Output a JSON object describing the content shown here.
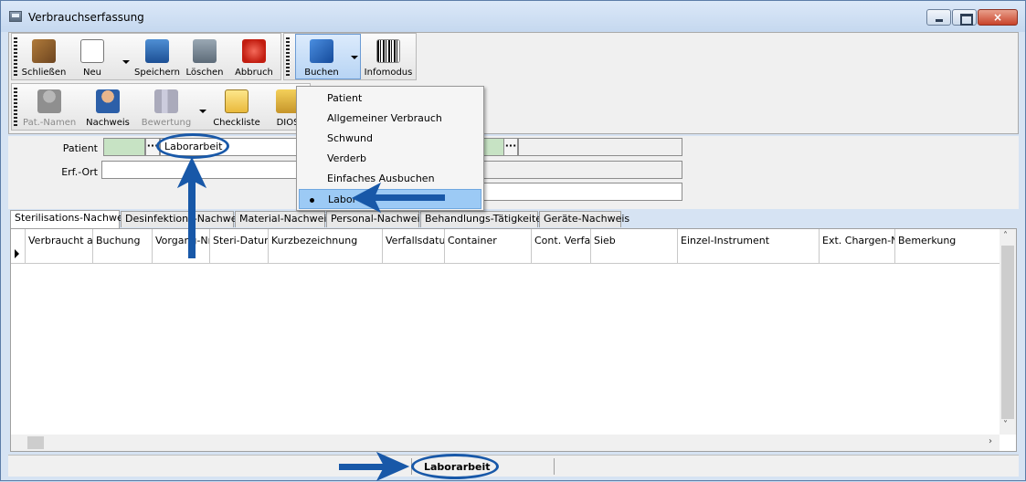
{
  "window": {
    "title": "Verbrauchserfassung",
    "close_glyph": "×"
  },
  "toolbar1": {
    "close": "Schließen",
    "new": "Neu",
    "save": "Speichern",
    "delete": "Löschen",
    "abort": "Abbruch",
    "book": "Buchen",
    "infomode": "Infomodus"
  },
  "toolbar2": {
    "patient_names": "Pat.-Namen",
    "evidence": "Nachweis",
    "rating": "Bewertung",
    "checklist": "Checkliste",
    "dios": "DIOS"
  },
  "fields": {
    "patient_label": "Patient",
    "location_label": "Erf.-Ort",
    "patient_value": "Laborarbeit",
    "dots": "···"
  },
  "booking_menu": {
    "items": [
      "Patient",
      "Allgemeiner Verbrauch",
      "Schwund",
      "Verderb",
      "Einfaches Ausbuchen",
      "Labor"
    ],
    "selected": "Labor"
  },
  "tabs": [
    "Sterilisations-Nachweis",
    "Desinfektions-Nachweis",
    "Material-Nachweis",
    "Personal-Nachweis",
    "Behandlungs-Tätigkeiten",
    "Geräte-Nachweis"
  ],
  "active_tab": "Sterilisations-Nachweis",
  "grid": {
    "columns": [
      "Verbraucht am",
      "Buchung",
      "Vorgang-Nr.",
      "Steri-Datum",
      "Kurzbezeichnung",
      "Verfallsdatum",
      "Container",
      "Cont. Verfall",
      "Sieb",
      "Einzel-Instrument",
      "Ext. Chargen-Nr.",
      "Bemerkung"
    ]
  },
  "statusbar": {
    "mode": "Laborarbeit"
  },
  "scroll": {
    "up": "˄",
    "down": "˅",
    "right": "›"
  },
  "colors": {
    "annotation": "#1858a8",
    "menu_highlight": "#9ccaf5",
    "patient_field": "#c7e3c4"
  }
}
